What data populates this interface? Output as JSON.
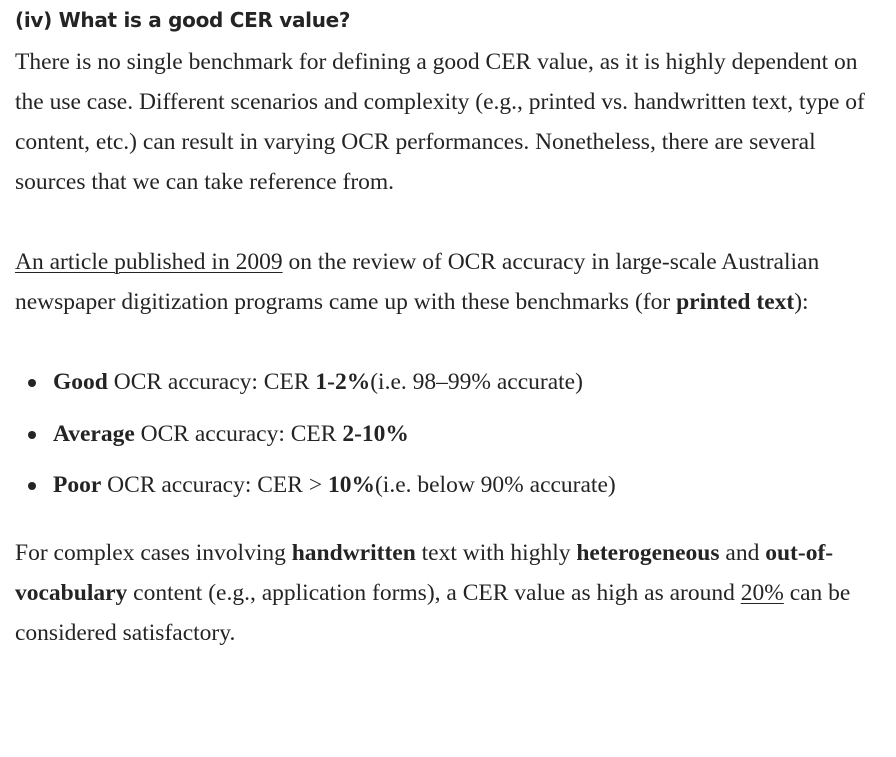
{
  "heading": "(iv) What is a good CER value?",
  "intro": "There is no single benchmark for defining a good CER value, as it is highly dependent on the use case. Different scenarios and complexity (e.g., printed vs. handwritten text, type of content, etc.) can result in varying OCR performances. Nonetheless, there are several sources that we can take reference from.",
  "source": {
    "link_text": "An article published in 2009",
    "text_1": " on the review of OCR accuracy in large-scale Australian newspaper digitization programs came up with these benchmarks (for ",
    "bold": "printed text",
    "text_2": "):"
  },
  "bullets": [
    {
      "lead": "Good",
      "text": " OCR accuracy: CER ",
      "value": "1-2%",
      "suffix": "(i.e. 98–99% accurate)"
    },
    {
      "lead": "Average",
      "text": " OCR accuracy: CER ",
      "value": "2-10%",
      "suffix": ""
    },
    {
      "lead": "Poor",
      "text": " OCR accuracy: CER > ",
      "value": "10%",
      "suffix": "(i.e. below 90% accurate)"
    }
  ],
  "complex": {
    "t1": "For complex cases involving ",
    "b1": "handwritten",
    "t2": " text with highly ",
    "b2": "heterogeneous",
    "t3": " and ",
    "b3": "out-of-vocabulary",
    "t4": " content (e.g., application forms), a CER value as high as around ",
    "link": "20%",
    "t5": " can be considered satisfactory."
  }
}
